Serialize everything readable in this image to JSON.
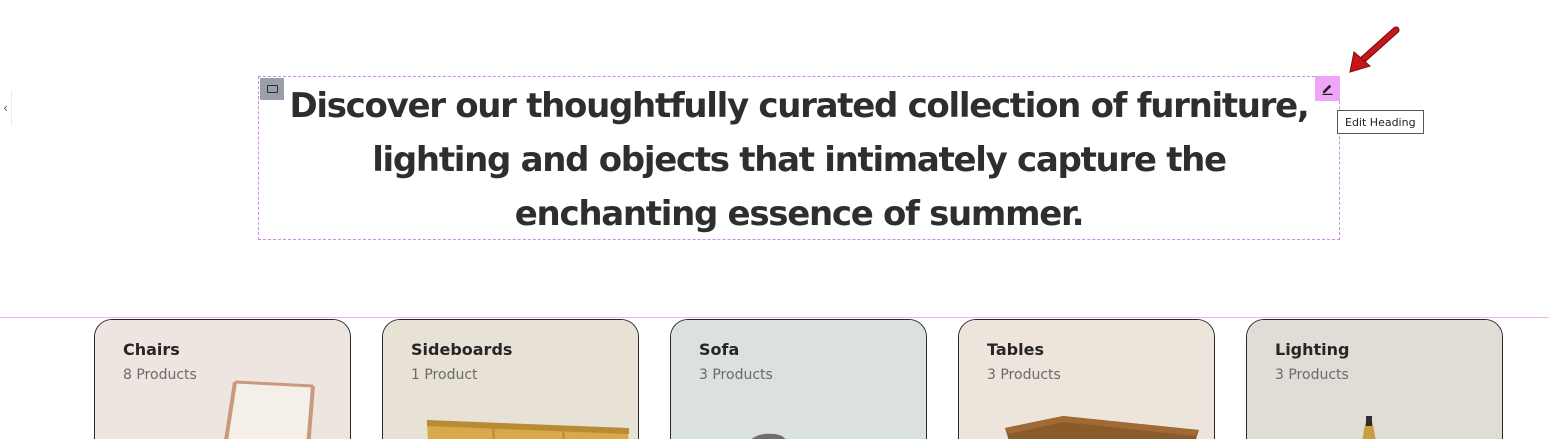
{
  "sidebar": {
    "collapse_glyph": "‹"
  },
  "heading": {
    "text": "Discover our thoughtfully curated collection of furniture, lighting and objects that intimately capture the enchanting essence of summer."
  },
  "editor": {
    "tooltip": "Edit Heading",
    "accent_color": "#f0a6f7",
    "outline_color": "#d08ae0",
    "edit_icon": "pencil-icon",
    "handle_icon": "section-handle-icon",
    "pointer": "red-arrow"
  },
  "categories": [
    {
      "title": "Chairs",
      "count": "8 Products",
      "bg": "#efe5e0",
      "icon": "chair-image"
    },
    {
      "title": "Sideboards",
      "count": "1 Product",
      "bg": "#e8e2d6",
      "icon": "sideboard-image"
    },
    {
      "title": "Sofa",
      "count": "3 Products",
      "bg": "#dbe1dc",
      "icon": "sofa-image"
    },
    {
      "title": "Tables",
      "count": "3 Products",
      "bg": "#ede5db",
      "icon": "table-image"
    },
    {
      "title": "Lighting",
      "count": "3 Products",
      "bg": "#e0dcd6",
      "icon": "lamp-image"
    }
  ]
}
